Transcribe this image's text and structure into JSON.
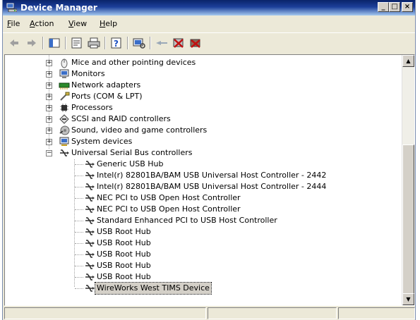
{
  "window": {
    "title": "Device Manager",
    "controls": {
      "minimize": "_",
      "maximize": "□",
      "close": "×"
    }
  },
  "menu": [
    {
      "label": "File",
      "mnemonic": "F",
      "rest": "ile"
    },
    {
      "label": "Action",
      "mnemonic": "A",
      "rest": "ction"
    },
    {
      "label": "View",
      "mnemonic": "V",
      "rest": "iew"
    },
    {
      "label": "Help",
      "mnemonic": "H",
      "rest": "elp"
    }
  ],
  "toolbar": [
    "back-icon",
    "forward-icon",
    "show-hide-console-tree-icon",
    "properties-icon",
    "print-icon",
    "help-icon",
    "scan-hardware-icon",
    "update-driver-icon",
    "uninstall-icon",
    "disable-icon"
  ],
  "tree": {
    "collapsed_categories": [
      {
        "label": "Mice and other pointing devices",
        "icon": "mouse-icon"
      },
      {
        "label": "Monitors",
        "icon": "monitor-icon"
      },
      {
        "label": "Network adapters",
        "icon": "network-adapter-icon"
      },
      {
        "label": "Ports (COM & LPT)",
        "icon": "port-icon"
      },
      {
        "label": "Processors",
        "icon": "processor-icon"
      },
      {
        "label": "SCSI and RAID controllers",
        "icon": "scsi-icon"
      },
      {
        "label": "Sound, video and game controllers",
        "icon": "sound-icon"
      },
      {
        "label": "System devices",
        "icon": "system-devices-icon"
      }
    ],
    "expanded_category": {
      "label": "Universal Serial Bus controllers",
      "icon": "usb-icon"
    },
    "usb_devices": [
      "Generic USB Hub",
      "Intel(r) 82801BA/BAM USB Universal Host Controller - 2442",
      "Intel(r) 82801BA/BAM USB Universal Host Controller - 2444",
      "NEC PCI to USB Open Host Controller",
      "NEC PCI to USB Open Host Controller",
      "Standard Enhanced PCI to USB Host Controller",
      "USB Root Hub",
      "USB Root Hub",
      "USB Root Hub",
      "USB Root Hub",
      "USB Root Hub",
      "WireWorks West TIMS Device"
    ],
    "selected": "WireWorks West TIMS Device"
  },
  "colors": {
    "title_bar": "#0a246a",
    "face": "#ece9d8",
    "selection": "#d4d0c8"
  },
  "statusbar": {
    "cells": [
      "",
      "",
      ""
    ]
  }
}
